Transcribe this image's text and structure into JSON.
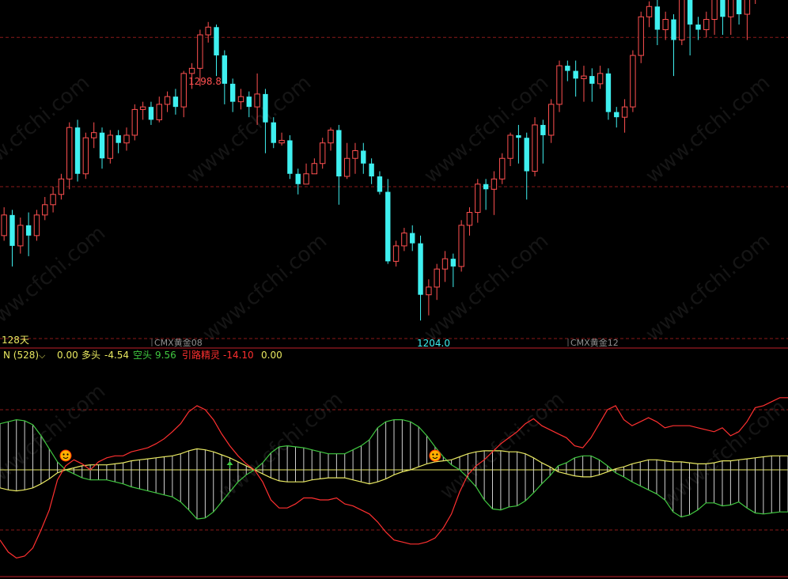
{
  "colors": {
    "background": "#000000",
    "bull": "#ff5050",
    "bear": "#3ff0f0",
    "dashed_grid": "#8b1a1a",
    "divider": "#c0202a",
    "yellow": "#e8e860",
    "green": "#40c840",
    "red": "#ff3030",
    "white": "#d0d0d0",
    "watermark": "#151515"
  },
  "watermark_text": "www.cfchi.com",
  "main_panel": {
    "high_label": "1298.8",
    "low_label": "1204.0",
    "period_label": "128天",
    "contract_labels": [
      "CMX黄金08",
      "CMX黄金12"
    ]
  },
  "indicator_header": {
    "name": "N (528)",
    "value0": "0.00",
    "bull_label": "多头",
    "bull_value": "-4.54",
    "bear_label": "空头",
    "bear_value": "9.56",
    "spirit_label": "引路精灵",
    "spirit_value": "-14.10",
    "extra_value": "0.00"
  },
  "chart_data": [
    {
      "type": "candlestick",
      "title": "",
      "ylim": [
        1200,
        1330
      ],
      "candles": [
        [
          1240,
          1248,
          1238,
          1251
        ],
        [
          1248,
          1236,
          1228,
          1250
        ],
        [
          1236,
          1244,
          1233,
          1247
        ],
        [
          1244,
          1240,
          1232,
          1249
        ],
        [
          1240,
          1248,
          1238,
          1250
        ],
        [
          1248,
          1252,
          1246,
          1255
        ],
        [
          1252,
          1256,
          1249,
          1259
        ],
        [
          1256,
          1262,
          1254,
          1264
        ],
        [
          1262,
          1282,
          1258,
          1284
        ],
        [
          1282,
          1264,
          1261,
          1285
        ],
        [
          1264,
          1278,
          1262,
          1280
        ],
        [
          1278,
          1280,
          1274,
          1284
        ],
        [
          1280,
          1270,
          1266,
          1282
        ],
        [
          1270,
          1279,
          1268,
          1281
        ],
        [
          1279,
          1276,
          1272,
          1281
        ],
        [
          1276,
          1279,
          1273,
          1282
        ],
        [
          1279,
          1289,
          1277,
          1291
        ],
        [
          1289,
          1290,
          1285,
          1292
        ],
        [
          1290,
          1285,
          1283,
          1292
        ],
        [
          1285,
          1291,
          1284,
          1294
        ],
        [
          1291,
          1294,
          1288,
          1296
        ],
        [
          1294,
          1290,
          1287,
          1297
        ],
        [
          1290,
          1303,
          1286,
          1304
        ],
        [
          1303,
          1305,
          1297,
          1307
        ],
        [
          1305,
          1318,
          1298,
          1320
        ],
        [
          1318,
          1321,
          1315,
          1323
        ],
        [
          1321,
          1310,
          1302,
          1322
        ],
        [
          1310,
          1299,
          1291,
          1312
        ],
        [
          1299,
          1292,
          1288,
          1301
        ],
        [
          1292,
          1294,
          1289,
          1297
        ],
        [
          1294,
          1290,
          1286,
          1296
        ],
        [
          1290,
          1295,
          1283,
          1303
        ],
        [
          1295,
          1284,
          1272,
          1297
        ],
        [
          1284,
          1276,
          1274,
          1286
        ],
        [
          1276,
          1277,
          1275,
          1280
        ],
        [
          1277,
          1264,
          1262,
          1279
        ],
        [
          1264,
          1260,
          1256,
          1266
        ],
        [
          1260,
          1264,
          1261,
          1268
        ],
        [
          1264,
          1268,
          1265,
          1270
        ],
        [
          1268,
          1276,
          1266,
          1278
        ],
        [
          1276,
          1281,
          1273,
          1282
        ],
        [
          1281,
          1263,
          1252,
          1283
        ],
        [
          1263,
          1270,
          1262,
          1276
        ],
        [
          1270,
          1273,
          1264,
          1276
        ],
        [
          1273,
          1268,
          1264,
          1276
        ],
        [
          1268,
          1263,
          1260,
          1270
        ],
        [
          1263,
          1257,
          1256,
          1265
        ],
        [
          1257,
          1230,
          1229,
          1262
        ],
        [
          1230,
          1236,
          1228,
          1238
        ],
        [
          1236,
          1241,
          1234,
          1243
        ],
        [
          1241,
          1237,
          1234,
          1244
        ],
        [
          1237,
          1217,
          1207,
          1240
        ],
        [
          1217,
          1220,
          1209,
          1223
        ],
        [
          1220,
          1227,
          1215,
          1229
        ],
        [
          1227,
          1231,
          1222,
          1234
        ],
        [
          1231,
          1228,
          1220,
          1233
        ],
        [
          1228,
          1244,
          1226,
          1246
        ],
        [
          1244,
          1249,
          1240,
          1251
        ],
        [
          1249,
          1260,
          1245,
          1262
        ],
        [
          1260,
          1258,
          1250,
          1262
        ],
        [
          1258,
          1262,
          1248,
          1265
        ],
        [
          1262,
          1270,
          1260,
          1272
        ],
        [
          1270,
          1279,
          1267,
          1280
        ],
        [
          1279,
          1278,
          1268,
          1283
        ],
        [
          1278,
          1265,
          1254,
          1280
        ],
        [
          1265,
          1283,
          1263,
          1286
        ],
        [
          1283,
          1279,
          1268,
          1285
        ],
        [
          1279,
          1291,
          1276,
          1293
        ],
        [
          1291,
          1306,
          1288,
          1308
        ],
        [
          1306,
          1304,
          1300,
          1308
        ],
        [
          1304,
          1301,
          1294,
          1308
        ],
        [
          1301,
          1302,
          1292,
          1306
        ],
        [
          1302,
          1299,
          1292,
          1305
        ],
        [
          1299,
          1303,
          1297,
          1306
        ],
        [
          1303,
          1288,
          1285,
          1305
        ],
        [
          1288,
          1286,
          1282,
          1290
        ],
        [
          1286,
          1290,
          1280,
          1293
        ],
        [
          1290,
          1310,
          1288,
          1312
        ],
        [
          1310,
          1325,
          1307,
          1327
        ],
        [
          1325,
          1329,
          1321,
          1331
        ],
        [
          1329,
          1320,
          1314,
          1333
        ],
        [
          1320,
          1324,
          1316,
          1327
        ],
        [
          1324,
          1316,
          1302,
          1326
        ],
        [
          1316,
          1332,
          1314,
          1335
        ],
        [
          1332,
          1322,
          1310,
          1334
        ],
        [
          1322,
          1320,
          1316,
          1325
        ],
        [
          1320,
          1324,
          1317,
          1327
        ],
        [
          1324,
          1333,
          1318,
          1338
        ],
        [
          1333,
          1325,
          1318,
          1336
        ],
        [
          1325,
          1332,
          1318,
          1335
        ],
        [
          1332,
          1326,
          1322,
          1334
        ],
        [
          1326,
          1336,
          1316,
          1338
        ],
        [
          1336,
          1348,
          1330,
          1350
        ],
        [
          1348,
          1355,
          1343,
          1365
        ],
        [
          1355,
          1360,
          1348,
          1360
        ],
        [
          1360,
          1361,
          1353,
          1368
        ]
      ],
      "grid_levels": [
        1200,
        1259,
        1317
      ]
    },
    {
      "type": "line",
      "title": "N (528)",
      "ylim": [
        -1,
        1
      ],
      "series": [
        {
          "name": "多头",
          "color": "yellow",
          "values": [
            -0.18,
            -0.2,
            -0.21,
            -0.2,
            -0.18,
            -0.14,
            -0.09,
            -0.03,
            0.0,
            0.02,
            0.04,
            0.05,
            0.05,
            0.05,
            0.06,
            0.07,
            0.09,
            0.1,
            0.11,
            0.12,
            0.13,
            0.14,
            0.16,
            0.19,
            0.21,
            0.2,
            0.18,
            0.15,
            0.12,
            0.08,
            0.04,
            0.0,
            -0.04,
            -0.08,
            -0.11,
            -0.12,
            -0.12,
            -0.12,
            -0.1,
            -0.09,
            -0.08,
            -0.08,
            -0.08,
            -0.1,
            -0.12,
            -0.14,
            -0.12,
            -0.09,
            -0.05,
            -0.02,
            0.0,
            0.03,
            0.06,
            0.08,
            0.09,
            0.1,
            0.13,
            0.16,
            0.18,
            0.19,
            0.19,
            0.19,
            0.18,
            0.18,
            0.16,
            0.12,
            0.07,
            0.03,
            -0.02,
            -0.04,
            -0.06,
            -0.07,
            -0.07,
            -0.05,
            -0.02,
            0.01,
            0.03,
            0.06,
            0.08,
            0.1,
            0.1,
            0.09,
            0.08,
            0.08,
            0.07,
            0.06,
            0.06,
            0.07,
            0.09,
            0.09,
            0.1,
            0.11,
            0.12,
            0.13,
            0.14,
            0.14,
            0.14
          ]
        },
        {
          "name": "空头",
          "color": "green",
          "values": [
            0.46,
            0.48,
            0.5,
            0.49,
            0.45,
            0.34,
            0.21,
            0.08,
            0.0,
            -0.04,
            -0.08,
            -0.1,
            -0.1,
            -0.1,
            -0.12,
            -0.14,
            -0.17,
            -0.19,
            -0.21,
            -0.23,
            -0.25,
            -0.27,
            -0.32,
            -0.4,
            -0.49,
            -0.48,
            -0.42,
            -0.32,
            -0.22,
            -0.12,
            -0.05,
            0.0,
            0.07,
            0.17,
            0.23,
            0.24,
            0.23,
            0.22,
            0.2,
            0.18,
            0.16,
            0.16,
            0.16,
            0.2,
            0.24,
            0.3,
            0.42,
            0.48,
            0.5,
            0.5,
            0.48,
            0.43,
            0.34,
            0.23,
            0.13,
            0.05,
            0.0,
            -0.08,
            -0.17,
            -0.3,
            -0.39,
            -0.4,
            -0.37,
            -0.36,
            -0.31,
            -0.23,
            -0.14,
            -0.06,
            0.04,
            0.07,
            0.12,
            0.14,
            0.14,
            0.1,
            0.04,
            -0.03,
            -0.07,
            -0.12,
            -0.16,
            -0.2,
            -0.24,
            -0.3,
            -0.42,
            -0.47,
            -0.45,
            -0.4,
            -0.33,
            -0.33,
            -0.36,
            -0.35,
            -0.32,
            -0.38,
            -0.43,
            -0.44,
            -0.43,
            -0.42,
            -0.42
          ]
        },
        {
          "name": "引路精灵",
          "color": "red",
          "values": [
            -0.7,
            -0.82,
            -0.88,
            -0.86,
            -0.78,
            -0.6,
            -0.4,
            -0.1,
            0.04,
            0.1,
            0.06,
            0.0,
            0.08,
            0.12,
            0.14,
            0.14,
            0.18,
            0.2,
            0.22,
            0.26,
            0.31,
            0.38,
            0.46,
            0.58,
            0.64,
            0.6,
            0.5,
            0.36,
            0.24,
            0.14,
            0.06,
            0.0,
            -0.12,
            -0.3,
            -0.38,
            -0.38,
            -0.34,
            -0.28,
            -0.28,
            -0.3,
            -0.3,
            -0.28,
            -0.34,
            -0.36,
            -0.4,
            -0.44,
            -0.52,
            -0.62,
            -0.7,
            -0.72,
            -0.74,
            -0.74,
            -0.72,
            -0.68,
            -0.58,
            -0.44,
            -0.22,
            -0.05,
            0.04,
            0.1,
            0.18,
            0.26,
            0.32,
            0.38,
            0.46,
            0.51,
            0.44,
            0.4,
            0.36,
            0.32,
            0.24,
            0.22,
            0.32,
            0.46,
            0.6,
            0.64,
            0.5,
            0.44,
            0.48,
            0.52,
            0.48,
            0.42,
            0.44,
            0.44,
            0.44,
            0.42,
            0.4,
            0.38,
            0.42,
            0.34,
            0.38,
            0.48,
            0.62,
            0.64,
            0.68,
            0.72,
            0.72
          ]
        }
      ],
      "markers": [
        {
          "type": "smiley-icon",
          "index": 8
        },
        {
          "type": "up-arrow-icon",
          "index": 28
        },
        {
          "type": "smiley-icon",
          "index": 53
        }
      ]
    }
  ]
}
